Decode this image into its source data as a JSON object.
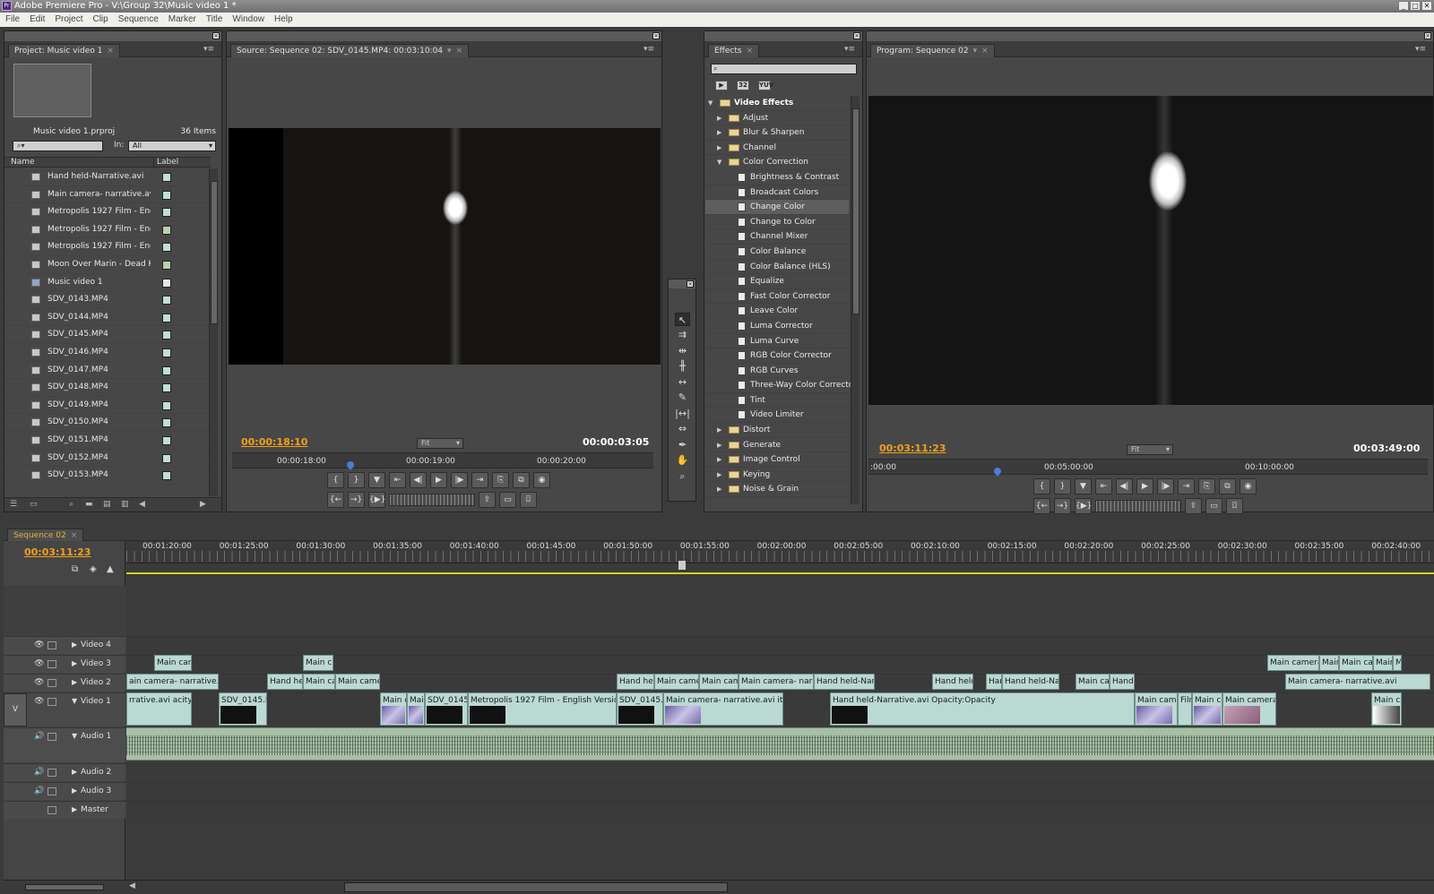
{
  "window": {
    "title": "Adobe Premiere Pro - V:\\Group 32\\Music video 1 *",
    "app_icon": "Pr",
    "controls": [
      "_",
      "□",
      "✕"
    ]
  },
  "menu": [
    "File",
    "Edit",
    "Project",
    "Clip",
    "Sequence",
    "Marker",
    "Title",
    "Window",
    "Help"
  ],
  "project": {
    "tab": "Project: Music video 1",
    "file": "Music video 1.prproj",
    "count": "36 Items",
    "in_label": "In:",
    "in_value": "All",
    "columns": [
      "Name",
      "Label"
    ],
    "items": [
      {
        "name": "Hand held-Narrative.avi",
        "type": "clip",
        "color": "#bfe0d9"
      },
      {
        "name": "Main camera- narrative.avi",
        "type": "clip",
        "color": "#bfe0d9"
      },
      {
        "name": "Metropolis 1927 Film - Engli",
        "type": "clip",
        "color": "#bfe0d9"
      },
      {
        "name": "Metropolis 1927 Film - Engli",
        "type": "audio",
        "color": "#b5d3ad"
      },
      {
        "name": "Metropolis 1927 Film - Engli",
        "type": "clip",
        "color": "#bfe0d9"
      },
      {
        "name": "Moon Over Marin - Dead Ke",
        "type": "audio",
        "color": "#b5d3ad"
      },
      {
        "name": "Music video 1",
        "type": "seq",
        "color": "#dfe7e8"
      },
      {
        "name": "SDV_0143.MP4",
        "type": "clip",
        "color": "#bfe0d9"
      },
      {
        "name": "SDV_0144.MP4",
        "type": "clip",
        "color": "#bfe0d9"
      },
      {
        "name": "SDV_0145.MP4",
        "type": "clip",
        "color": "#bfe0d9"
      },
      {
        "name": "SDV_0146.MP4",
        "type": "clip",
        "color": "#bfe0d9"
      },
      {
        "name": "SDV_0147.MP4",
        "type": "clip",
        "color": "#bfe0d9"
      },
      {
        "name": "SDV_0148.MP4",
        "type": "clip",
        "color": "#bfe0d9"
      },
      {
        "name": "SDV_0149.MP4",
        "type": "clip",
        "color": "#bfe0d9"
      },
      {
        "name": "SDV_0150.MP4",
        "type": "clip",
        "color": "#bfe0d9"
      },
      {
        "name": "SDV_0151.MP4",
        "type": "clip",
        "color": "#bfe0d9"
      },
      {
        "name": "SDV_0152.MP4",
        "type": "clip",
        "color": "#bfe0d9"
      },
      {
        "name": "SDV_0153.MP4",
        "type": "clip",
        "color": "#bfe0d9"
      }
    ]
  },
  "source": {
    "tab": "Source: Sequence 02: SDV_0145.MP4: 00:03:10:04",
    "timecode_in": "00:00:18:10",
    "timecode_dur": "00:00:03:05",
    "fit": "Fit",
    "ruler": [
      "00:00:18:00",
      "00:00:19:00",
      "00:00:20:00"
    ]
  },
  "effects": {
    "tab": "Effects",
    "buttons": [
      "32",
      "YUV"
    ],
    "tree": [
      {
        "name": "Video Effects",
        "level": 0,
        "kind": "folder",
        "open": true,
        "bold": true
      },
      {
        "name": "Adjust",
        "level": 1,
        "kind": "folder"
      },
      {
        "name": "Blur & Sharpen",
        "level": 1,
        "kind": "folder"
      },
      {
        "name": "Channel",
        "level": 1,
        "kind": "folder"
      },
      {
        "name": "Color Correction",
        "level": 1,
        "kind": "folder",
        "open": true
      },
      {
        "name": "Brightness & Contrast",
        "level": 2,
        "kind": "effect"
      },
      {
        "name": "Broadcast Colors",
        "level": 2,
        "kind": "effect"
      },
      {
        "name": "Change Color",
        "level": 2,
        "kind": "effect",
        "selected": true
      },
      {
        "name": "Change to Color",
        "level": 2,
        "kind": "effect"
      },
      {
        "name": "Channel Mixer",
        "level": 2,
        "kind": "effect"
      },
      {
        "name": "Color Balance",
        "level": 2,
        "kind": "effect"
      },
      {
        "name": "Color Balance (HLS)",
        "level": 2,
        "kind": "effect"
      },
      {
        "name": "Equalize",
        "level": 2,
        "kind": "effect"
      },
      {
        "name": "Fast Color Corrector",
        "level": 2,
        "kind": "effect"
      },
      {
        "name": "Leave Color",
        "level": 2,
        "kind": "effect"
      },
      {
        "name": "Luma Corrector",
        "level": 2,
        "kind": "effect"
      },
      {
        "name": "Luma Curve",
        "level": 2,
        "kind": "effect"
      },
      {
        "name": "RGB Color Corrector",
        "level": 2,
        "kind": "effect"
      },
      {
        "name": "RGB Curves",
        "level": 2,
        "kind": "effect"
      },
      {
        "name": "Three-Way Color Corrector",
        "level": 2,
        "kind": "effect"
      },
      {
        "name": "Tint",
        "level": 2,
        "kind": "effect"
      },
      {
        "name": "Video Limiter",
        "level": 2,
        "kind": "effect"
      },
      {
        "name": "Distort",
        "level": 1,
        "kind": "folder"
      },
      {
        "name": "Generate",
        "level": 1,
        "kind": "folder"
      },
      {
        "name": "Image Control",
        "level": 1,
        "kind": "folder"
      },
      {
        "name": "Keying",
        "level": 1,
        "kind": "folder"
      },
      {
        "name": "Noise & Grain",
        "level": 1,
        "kind": "folder"
      }
    ]
  },
  "program": {
    "tab": "Program: Sequence 02",
    "timecode_in": "00:03:11:23",
    "timecode_dur": "00:03:49:00",
    "fit": "Fit",
    "ruler": [
      ":00:00",
      "00:05:00:00",
      "00:10:00:00"
    ]
  },
  "sequence": {
    "tab": "Sequence 02",
    "timecode": "00:03:11:23",
    "ruler": [
      "00:01:20:00",
      "00:01:25:00",
      "00:01:30:00",
      "00:01:35:00",
      "00:01:40:00",
      "00:01:45:00",
      "00:01:50:00",
      "00:01:55:00",
      "00:02:00:00",
      "00:02:05:00",
      "00:02:10:00",
      "00:02:15:00",
      "00:02:20:00",
      "00:02:25:00",
      "00:02:30:00",
      "00:02:35:00",
      "00:02:40:00"
    ],
    "tracks": [
      "Video 4",
      "Video 3",
      "Video 2",
      "Video 1",
      "Audio 1",
      "Audio 2",
      "Audio 3",
      "Master"
    ],
    "v_label": "V",
    "v3_clips": [
      "Main cam",
      "Main c",
      "Main camera-",
      "Main",
      "Main can",
      "Main",
      "M"
    ],
    "v2_clips": [
      "ain camera- narrative.avi",
      "Hand held",
      "Main car",
      "Main camer",
      "Hand helc",
      "Main camer",
      "Main came",
      "Main camera- narrat",
      "Hand held-Narra",
      "Hand held-",
      "Har",
      "Hand held-Narr",
      "Main can",
      "Hand l",
      "Main camera- narrative.avi"
    ],
    "v1_clips": [
      "rrative.avi  acity",
      "SDV_0145.M",
      "Main c",
      "Mair",
      "SDV_0145.I",
      "Metropolis 1927 Film - English Version (1",
      "SDV_0145.M",
      "Main camera- narrative.avi  ity",
      "Hand held-Narrative.avi  Opacity:Opacity",
      "Main camer",
      "Film",
      "Main ca",
      "Main camera-",
      "Main ca"
    ]
  },
  "colors": {
    "accent_timecode": "#f0a018",
    "video_clip": "#bad9d3",
    "audio_clip": "#a6bfa5"
  }
}
